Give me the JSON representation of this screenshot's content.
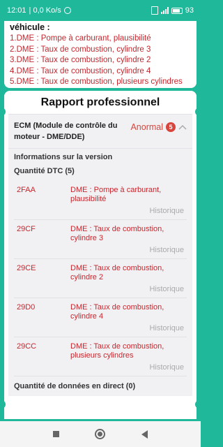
{
  "status_bar": {
    "time": "12:01",
    "network_speed": "| 0,0 Ko/s",
    "battery": "93"
  },
  "top_card": {
    "heading": "véhicule :",
    "faults": [
      "1.DME : Pompe à carburant, plausibilité",
      "2.DME : Taux de combustion, cylindre 3",
      "3.DME : Taux de combustion, cylindre 2",
      "4.DME : Taux de combustion, cylindre 4",
      "5.DME : Taux de combustion, plusieurs cylindres"
    ]
  },
  "report": {
    "title": "Rapport professionnel",
    "module_name": "ECM (Module de contrôle du moteur - DME/DDE)",
    "status": "Anormal",
    "status_count": "5",
    "version_info": "Informations sur la version",
    "dtc_count_label": "Quantité DTC (5)",
    "dtcs": [
      {
        "code": "2FAA",
        "description": "DME : Pompe à carburant, plausibilité",
        "history": "Historique"
      },
      {
        "code": "29CF",
        "description": "DME : Taux de combustion, cylindre 3",
        "history": "Historique"
      },
      {
        "code": "29CE",
        "description": "DME : Taux de combustion, cylindre 2",
        "history": "Historique"
      },
      {
        "code": "29D0",
        "description": "DME : Taux de combustion, cylindre 4",
        "history": "Historique"
      },
      {
        "code": "29CC",
        "description": "DME : Taux de combustion, plusieurs cylindres",
        "history": "Historique"
      }
    ],
    "live_data_label": "Quantité de données en direct (0)"
  },
  "colors": {
    "accent": "#1fb89a",
    "fault_red": "#c8252c",
    "status_red": "#d8453c"
  },
  "icons": [
    "alarm-icon",
    "signal-icon",
    "battery-icon",
    "chevron-up-icon",
    "nav-recents-icon",
    "nav-home-icon",
    "nav-back-icon"
  ]
}
